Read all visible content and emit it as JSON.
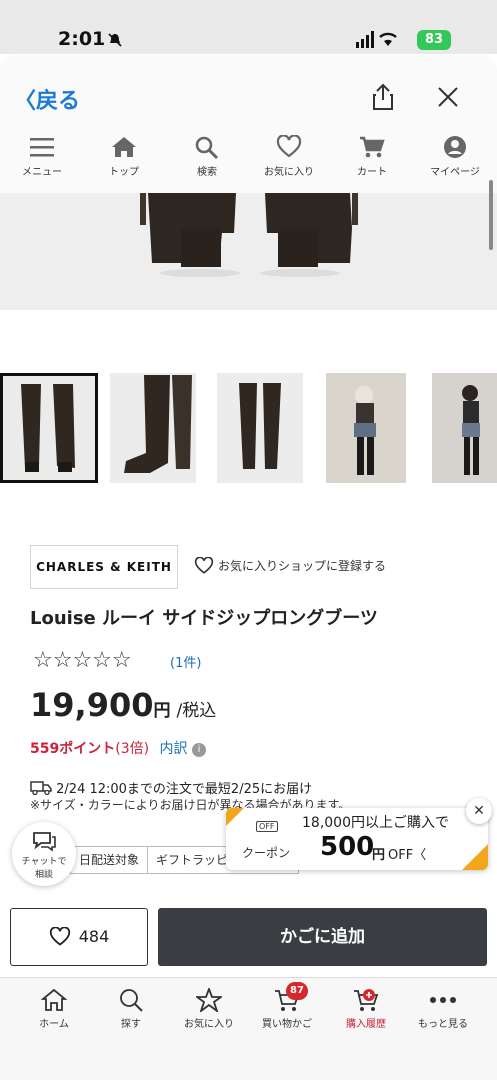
{
  "status_bar": {
    "time": "2:01",
    "battery": "83"
  },
  "browser": {
    "back_label": "〈戻る",
    "nav": [
      {
        "label": "メニュー",
        "icon": "menu-icon"
      },
      {
        "label": "トップ",
        "icon": "home-icon"
      },
      {
        "label": "検索",
        "icon": "search-icon"
      },
      {
        "label": "お気に入り",
        "icon": "heart-icon"
      },
      {
        "label": "カート",
        "icon": "cart-icon"
      },
      {
        "label": "マイページ",
        "icon": "account-icon"
      }
    ]
  },
  "product": {
    "brand": "CHARLES & KEITH",
    "fav_shop_label": "お気に入りショップに登録する",
    "title": "Louise ルーイ サイドジップロングブーツ",
    "stars": "☆☆☆☆☆",
    "reviews": "(1件)",
    "price_number": "19,900",
    "price_unit": "円",
    "tax_label": "/税込",
    "points": "559ポイント",
    "points_multiplier": "(3倍)",
    "points_detail": "内訳",
    "delivery": "2/24 12:00までの注文で最短2/25にお届け",
    "note": "※サイズ・カラーによりお届け日が異なる場合があります。",
    "tags": [
      "日配送対象",
      "ギフトラッピ"
    ]
  },
  "chat": {
    "label_line1": "チャットで",
    "label_line2": "相談"
  },
  "coupon": {
    "badge": "OFF",
    "label": "クーポン",
    "line1": "18,000円以上ご購入で",
    "amount": "500",
    "unit": "円",
    "off": "OFF〈"
  },
  "actions": {
    "fav_count": "484",
    "add_to_cart": "かごに追加"
  },
  "tabbar": [
    {
      "label": "ホーム",
      "icon": "home-icon"
    },
    {
      "label": "探す",
      "icon": "search-icon"
    },
    {
      "label": "お気に入り",
      "icon": "star-icon"
    },
    {
      "label": "買い物かご",
      "icon": "cart-icon"
    },
    {
      "label": "購入履歴",
      "icon": "history-icon"
    },
    {
      "label": "もっと見る",
      "icon": "more-icon"
    }
  ],
  "cart_badge": "87",
  "colors": {
    "link": "#1a7ad8",
    "accent_red": "#c8243b",
    "cart_button": "#3a3d42",
    "coupon_orange": "#f2a71b"
  }
}
